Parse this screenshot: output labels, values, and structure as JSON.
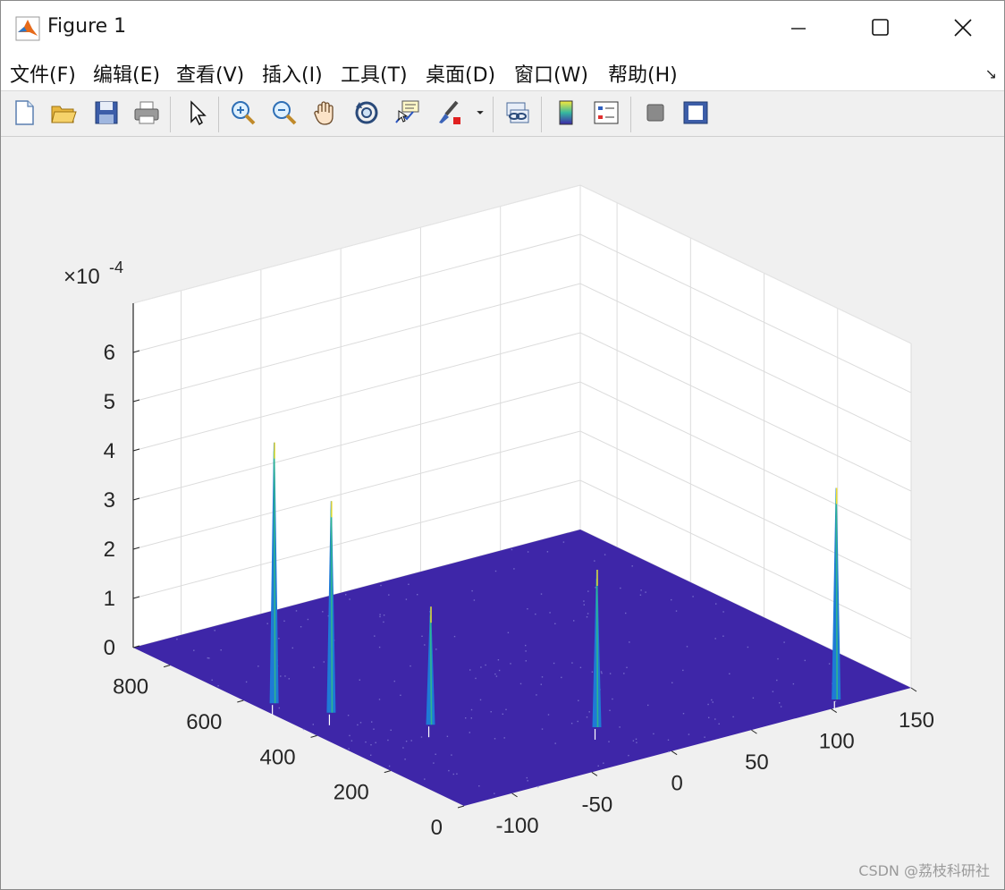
{
  "window": {
    "title": "Figure 1"
  },
  "menu": [
    {
      "label": "文件(F)"
    },
    {
      "label": "编辑(E)"
    },
    {
      "label": "查看(V)"
    },
    {
      "label": "插入(I)"
    },
    {
      "label": "工具(T)"
    },
    {
      "label": "桌面(D)"
    },
    {
      "label": "窗口(W)"
    },
    {
      "label": "帮助(H)"
    }
  ],
  "toolbar": [
    {
      "icon": "new-figure-icon"
    },
    {
      "icon": "open-file-icon"
    },
    {
      "icon": "save-icon"
    },
    {
      "icon": "print-icon"
    },
    {
      "icon": "pointer-icon"
    },
    {
      "icon": "zoom-in-icon"
    },
    {
      "icon": "zoom-out-icon"
    },
    {
      "icon": "pan-hand-icon"
    },
    {
      "icon": "rotate-3d-icon"
    },
    {
      "icon": "data-cursor-icon"
    },
    {
      "icon": "brush-icon"
    },
    {
      "icon": "link-plot-icon"
    },
    {
      "icon": "colorbar-icon"
    },
    {
      "icon": "legend-icon"
    },
    {
      "icon": "hide-plot-tools-icon"
    },
    {
      "icon": "show-plot-tools-icon"
    }
  ],
  "chart_data": {
    "type": "surface",
    "z_exponent_label": "×10",
    "z_exponent": "-4",
    "z_ticks": [
      "0",
      "1",
      "2",
      "3",
      "4",
      "5",
      "6"
    ],
    "z_lim": [
      0,
      7
    ],
    "y_ticks": [
      "0",
      "200",
      "400",
      "600",
      "800"
    ],
    "y_lim": [
      0,
      900
    ],
    "x_ticks": [
      "-100",
      "-50",
      "0",
      "50",
      "100",
      "150"
    ],
    "x_lim": [
      -130,
      150
    ],
    "grid": true,
    "surface_color": "#3e26a8",
    "peaks": [
      {
        "x": -120,
        "y": 560,
        "z": 5.3
      },
      {
        "x": -105,
        "y": 470,
        "z": 4.3
      },
      {
        "x": -75,
        "y": 330,
        "z": 2.4
      },
      {
        "x": -10,
        "y": 160,
        "z": 3.2
      },
      {
        "x": 110,
        "y": 30,
        "z": 4.3
      }
    ]
  },
  "watermark": "CSDN @荔枝科研社"
}
